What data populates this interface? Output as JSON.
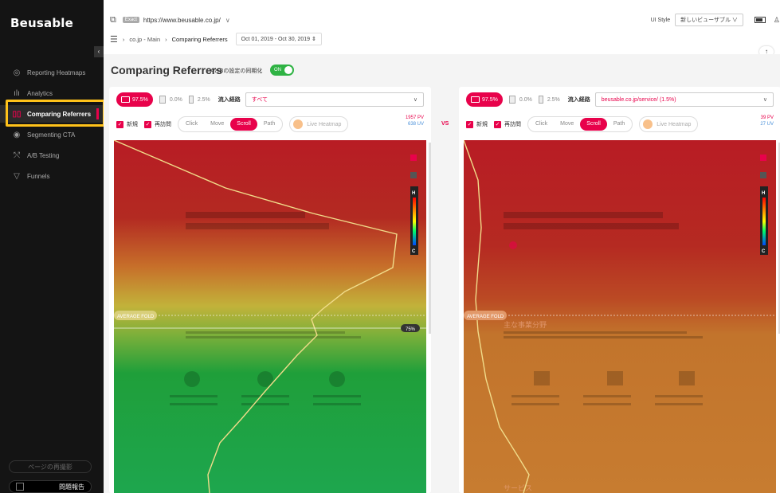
{
  "app": {
    "logo": "Beusable"
  },
  "sidebar": {
    "items": [
      {
        "label": "Reporting Heatmaps",
        "icon": "target-icon"
      },
      {
        "label": "Analytics",
        "icon": "bar-chart-icon"
      },
      {
        "label": "Comparing Referrers",
        "icon": "compare-icon"
      },
      {
        "label": "Segmenting CTA",
        "icon": "fingerprint-icon"
      },
      {
        "label": "A/B Testing",
        "icon": "split-icon"
      },
      {
        "label": "Funnels",
        "icon": "funnel-icon"
      }
    ],
    "rerecord_label": "ページの再撮影",
    "report_label": "問題報告"
  },
  "topbar": {
    "match_badge": "Exact",
    "url": "https://www.beusable.co.jp/",
    "ui_style_label": "UI Style",
    "ui_style_value": "新しいビューザブル"
  },
  "breadcrumb": {
    "site": "co.jp - Main",
    "page": "Comparing Referrers",
    "date_range": "Oct 01, 2019 - Oct 30, 2019"
  },
  "page": {
    "title": "Comparing Referrers",
    "sync_label": "AとBの設定の同期化",
    "sync_toggle": "ON",
    "vs": "VS"
  },
  "panels": [
    {
      "desktop_pct": "97.5%",
      "tablet_pct": "0.0%",
      "mobile_pct": "2.5%",
      "referrer_label": "流入経路",
      "referrer_value": "すべて",
      "new_label": "新規",
      "return_label": "再訪問",
      "modes": [
        "Click",
        "Move",
        "Scroll",
        "Path"
      ],
      "active_mode": "Scroll",
      "live_label": "Live Heatmap",
      "pv": "1957 PV",
      "uv": "638 UV",
      "fold_label": "AVERAGE FOLD",
      "fold_pct": "75%"
    },
    {
      "desktop_pct": "97.5%",
      "tablet_pct": "0.0%",
      "mobile_pct": "2.5%",
      "referrer_label": "流入経路",
      "referrer_value": "beusable.co.jp/service/ (1.5%)",
      "new_label": "新規",
      "return_label": "再訪問",
      "modes": [
        "Click",
        "Move",
        "Scroll",
        "Path"
      ],
      "active_mode": "Scroll",
      "live_label": "Live Heatmap",
      "pv": "39 PV",
      "uv": "27 UV",
      "fold_label": "AVERAGE FOLD",
      "page_heading": "主な事業分野",
      "page_footer": "サービス"
    }
  ],
  "heatmap_legend": {
    "high": "H",
    "low": "C"
  },
  "colors": {
    "accent": "#e8024b",
    "highlight": "#ffc21a",
    "toggle_on": "#2fb344"
  }
}
